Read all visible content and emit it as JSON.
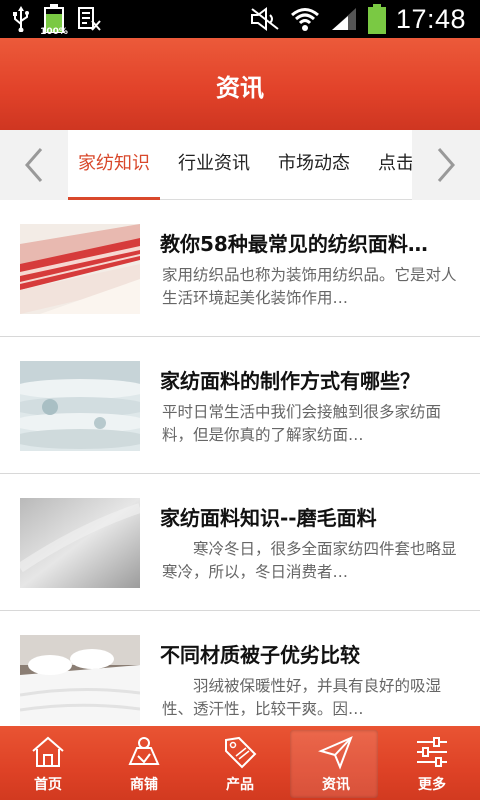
{
  "status_bar": {
    "icons": [
      "usb-icon",
      "battery-icon",
      "keyboard-icon",
      "mute-icon",
      "wifi-icon",
      "signal-icon",
      "battery-icon"
    ],
    "battery_percent_label": "100%",
    "time": "17:48"
  },
  "header": {
    "title": "资讯",
    "color": "#e2432a"
  },
  "tabs": {
    "prev_icon": "chevron-left-icon",
    "next_icon": "chevron-right-icon",
    "items": [
      {
        "label": "家纺知识",
        "active": true
      },
      {
        "label": "行业资讯",
        "active": false
      },
      {
        "label": "市场动态",
        "active": false
      },
      {
        "label": "点击",
        "active": false
      }
    ],
    "active_color": "#d9482b"
  },
  "articles": [
    {
      "title": "教你58种最常见的纺织面料…",
      "desc": "家用纺织品也称为装饰用纺织品。它是对人生活环境起美化装饰作用…"
    },
    {
      "title": "家纺面料的制作方式有哪些？",
      "desc": "平时日常生活中我们会接触到很多家纺面料，但是你真的了解家纺面…"
    },
    {
      "title": "家纺面料知识--磨毛面料",
      "desc": "　　寒冷冬日，很多全面家纺四件套也略显寒冷，所以，冬日消费者…"
    },
    {
      "title": "不同材质被子优劣比较",
      "desc": "　　羽绒被保暖性好，并具有良好的吸湿性、透汗性，比较干爽。因…"
    }
  ],
  "bottom_nav": {
    "items": [
      {
        "label": "首页",
        "icon": "home-icon",
        "active": false
      },
      {
        "label": "商铺",
        "icon": "shop-icon",
        "active": false
      },
      {
        "label": "产品",
        "icon": "sale-tag-icon",
        "active": false
      },
      {
        "label": "资讯",
        "icon": "paper-plane-icon",
        "active": true
      },
      {
        "label": "更多",
        "icon": "sliders-icon",
        "active": false
      }
    ]
  }
}
